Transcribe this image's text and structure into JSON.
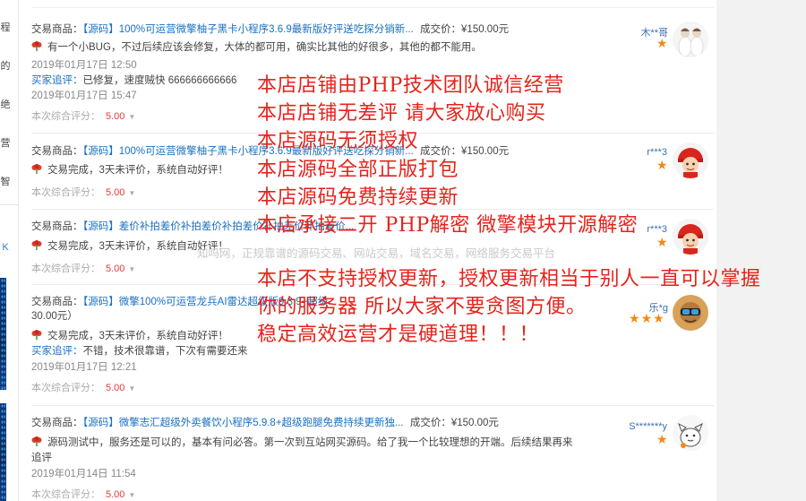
{
  "left_nav": {
    "glyphs": [
      "程",
      "的",
      "绝",
      "营",
      "智",
      "K"
    ]
  },
  "labels": {
    "product": "交易商品：",
    "chase": "买家追评：",
    "rating": "本次综合评分：",
    "price_prefix": "成交价："
  },
  "reviews": [
    {
      "product_title": "【源码】100%可运营微擎柚子黑卡小程序3.6.9最新版好评送吃探分销新...",
      "price": "¥150.00元",
      "comment": "有一个小BUG，不过后续应该会修复，大体的都可用，确实比其他的好很多，其他的都不能用。",
      "date": "2019年01月17日 12:50",
      "chase_text": "已修复，速度贼快 666666666666",
      "chase_date": "2019年01月17日 15:47",
      "score": "5.00",
      "nickname": "木**哥",
      "stars": 1
    },
    {
      "product_title": "【源码】100%可运营微擎柚子黑卡小程序3.6.9最新版好评送吃探分销新...",
      "price": "¥150.00元",
      "comment": "交易完成，3天未评价，系统自动好评！",
      "score": "5.00",
      "nickname": "r***3",
      "stars": 1
    },
    {
      "product_title": "【源码】差价补拍差价补拍差价补拍差价补拍差价补拍差价...",
      "price": "",
      "comment": "交易完成，3天未评价，系统自动好评！",
      "score": "5.00",
      "nickname": "r***3",
      "stars": 1
    },
    {
      "product_title": "【源码】微擎100%可运营龙兵AI雷达超级版9.3.9+超级...",
      "price_tail": "30.00元）",
      "comment": "交易完成，3天未评价，系统自动好评！",
      "chase_text": "不错，技术很靠谱，下次有需要还来",
      "chase_date": "2019年01月17日 12:21",
      "score": "5.00",
      "nickname": "乐*g",
      "stars": 3
    },
    {
      "product_title": "【源码】微擎志汇超级外卖餐饮小程序5.9.8+超级跑腿免费持续更新独...",
      "price": "¥150.00元",
      "comment": "源码测试中，服务还是可以的，基本有问必答。第一次到互站网买源码。给了我一个比较理想的开端。后续结果再来",
      "comment_tail": "追评",
      "date": "2019年01月14日 11:54",
      "score": "5.00",
      "nickname": "S*******y",
      "stars": 1
    }
  ],
  "overlay_lines": [
    "本店店铺由PHP技术团队诚信经营",
    "本店店铺无差评  请大家放心购买",
    "本店源码无须授权",
    "本店源码全部正版打包",
    "本店源码免费持续更新",
    "本店承接二开  PHP解密  微擎模块开源解密",
    "本店不支持授权更新，授权更新相当于别人一直可以掌握",
    "你的服务器 所以大家不要贪图方便。",
    "稳定高效运营才是硬道理！！！"
  ],
  "watermark": "知吗网，正规靠谱的源码交易、网站交易，域名交易，网络服务交易平台",
  "colors": {
    "overlay_red": "#e5231c",
    "link_blue": "#1a6fc1",
    "score_red": "#e4393c",
    "star_orange": "#f08a17"
  }
}
